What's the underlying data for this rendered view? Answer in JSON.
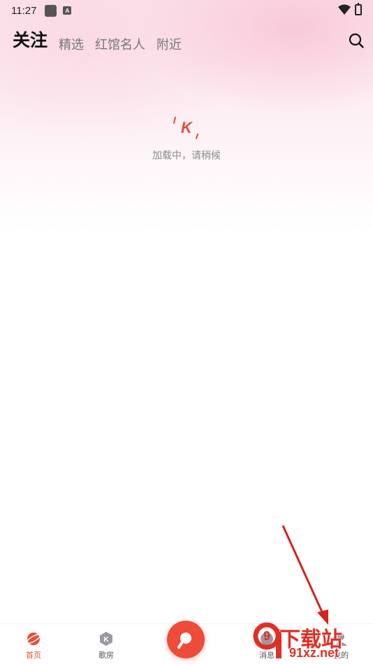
{
  "status_bar": {
    "time": "11:27",
    "app_badge_letter": "A"
  },
  "top_tabs": [
    {
      "label": "关注",
      "active": true
    },
    {
      "label": "精选",
      "active": false
    },
    {
      "label": "红馆名人",
      "active": false
    },
    {
      "label": "附近",
      "active": false
    }
  ],
  "loading": {
    "logo_letter": "K",
    "text": "加载中，请稍候"
  },
  "bottom_nav": {
    "items": [
      {
        "label": "首页",
        "icon": "planet-icon",
        "active": true
      },
      {
        "label": "歌房",
        "icon": "k-room-icon",
        "active": false
      },
      {
        "label": "",
        "icon": "search-mic-icon",
        "active": false
      },
      {
        "label": "消息",
        "icon": "message-icon",
        "active": false
      },
      {
        "label": "我的",
        "icon": "profile-icon",
        "active": false
      }
    ]
  },
  "watermark": {
    "title": "下载站",
    "site": "91xz.net",
    "number": "9"
  },
  "colors": {
    "accent": "#ef4b39",
    "active_tab": "#111111",
    "inactive_tab": "#777777"
  }
}
